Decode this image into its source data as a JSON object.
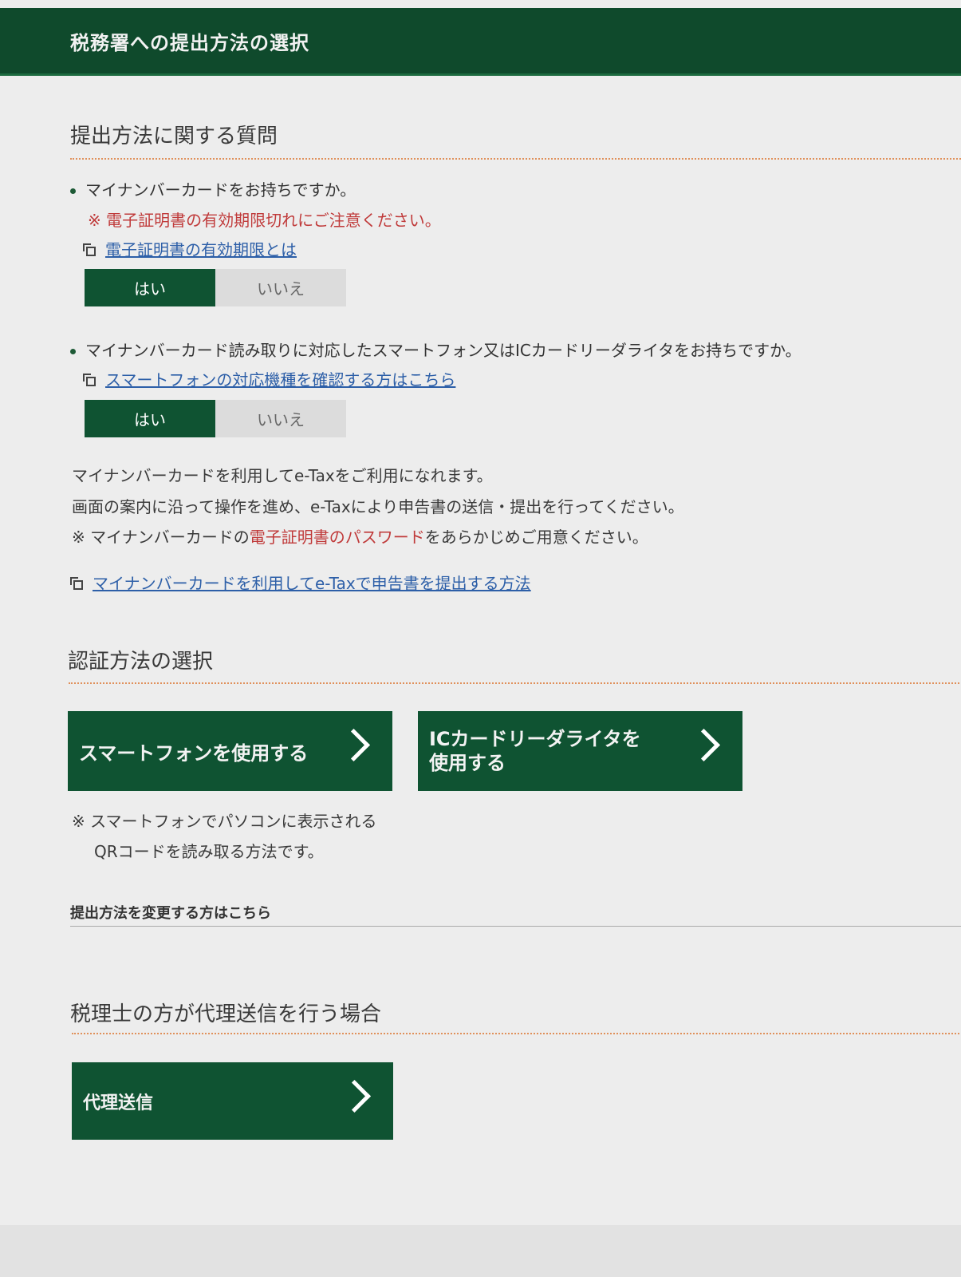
{
  "header": {
    "title": "税務署への提出方法の選択"
  },
  "section1": {
    "title": "提出方法に関する質問",
    "q1": {
      "text": "マイナンバーカードをお持ちですか。",
      "note": "※ 電子証明書の有効期限切れにご注意ください。",
      "link": "電子証明書の有効期限とは",
      "yes": "はい",
      "no": "いいえ",
      "selected": "はい"
    },
    "q2": {
      "text": "マイナンバーカード読み取りに対応したスマートフォン又はICカードリーダライタをお持ちですか。",
      "link": "スマートフォンの対応機種を確認する方はこちら",
      "yes": "はい",
      "no": "いいえ",
      "selected": "はい"
    },
    "info": {
      "line1": "マイナンバーカードを利用してe-Taxをご利用になれます。",
      "line2": "画面の案内に沿って操作を進め、e-Taxにより申告書の送信・提出を行ってください。",
      "line3_prefix": "※ マイナンバーカードの",
      "line3_red": "電子証明書のパスワード",
      "line3_suffix": "をあらかじめご用意ください。",
      "link": "マイナンバーカードを利用してe-Taxで申告書を提出する方法"
    }
  },
  "section2": {
    "title": "認証方法の選択",
    "smartphone_button": "スマートフォンを使用する",
    "icreader_button_line1": "ICカードリーダライタを",
    "icreader_button_line2": "使用する",
    "note_line1": "※ スマートフォンでパソコンに表示される",
    "note_line2": "QRコードを読み取る方法です。",
    "change_link": "提出方法を変更する方はこちら"
  },
  "section3": {
    "title": "税理士の方が代理送信を行う場合",
    "proxy_button": "代理送信"
  },
  "colors": {
    "brand_green": "#0f5332",
    "header_green": "#0f4a2c",
    "warning_red": "#c03a3a",
    "link_blue": "#2d5fa8"
  }
}
